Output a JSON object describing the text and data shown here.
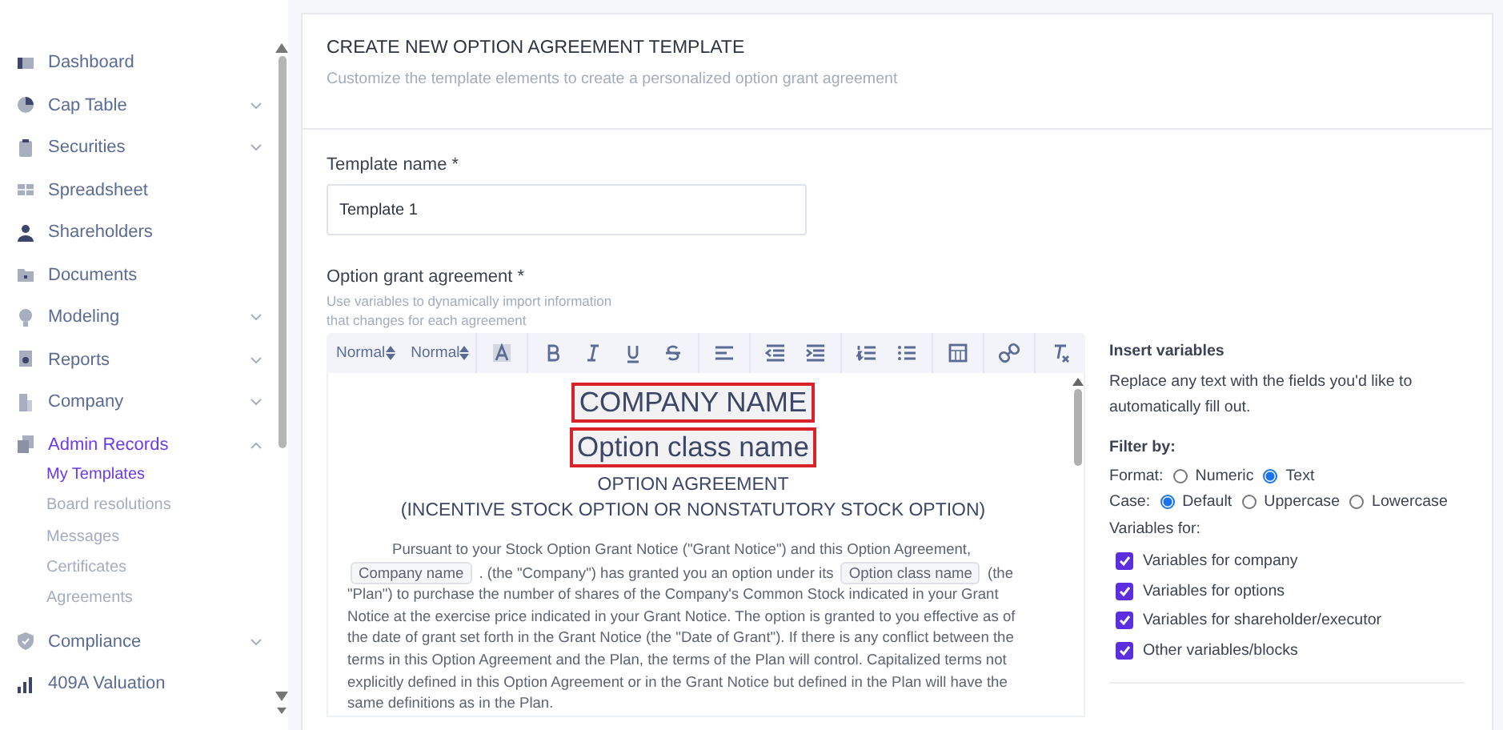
{
  "sidebar": {
    "items": [
      {
        "label": "Dashboard",
        "expandable": false,
        "expanded": false,
        "selected": false
      },
      {
        "label": "Cap Table",
        "expandable": true,
        "expanded": false,
        "selected": false
      },
      {
        "label": "Securities",
        "expandable": true,
        "expanded": false,
        "selected": false
      },
      {
        "label": "Spreadsheet",
        "expandable": false,
        "expanded": false,
        "selected": false
      },
      {
        "label": "Shareholders",
        "expandable": false,
        "expanded": false,
        "selected": false
      },
      {
        "label": "Documents",
        "expandable": false,
        "expanded": false,
        "selected": false
      },
      {
        "label": "Modeling",
        "expandable": true,
        "expanded": false,
        "selected": false
      },
      {
        "label": "Reports",
        "expandable": true,
        "expanded": false,
        "selected": false
      },
      {
        "label": "Company",
        "expandable": true,
        "expanded": false,
        "selected": false
      },
      {
        "label": "Admin Records",
        "expandable": true,
        "expanded": true,
        "selected": true,
        "children": [
          {
            "label": "My Templates",
            "selected": true
          },
          {
            "label": "Board resolutions",
            "selected": false
          },
          {
            "label": "Messages",
            "selected": false
          },
          {
            "label": "Certificates",
            "selected": false
          },
          {
            "label": "Agreements",
            "selected": false
          }
        ]
      },
      {
        "label": "Compliance",
        "expandable": true,
        "expanded": false,
        "selected": false
      },
      {
        "label": "409A Valuation",
        "expandable": false,
        "expanded": false,
        "selected": false
      }
    ]
  },
  "header": {
    "title": "CREATE NEW OPTION AGREEMENT TEMPLATE",
    "subtitle": "Customize the template elements to create a personalized option grant agreement"
  },
  "template_name": {
    "label": "Template name *",
    "value": "Template 1"
  },
  "agreement": {
    "label": "Option grant agreement *",
    "hint": "Use variables to dynamically import information that changes for each agreement",
    "toolbar": {
      "font": "Normal",
      "size": "Normal"
    },
    "document": {
      "headings": [
        {
          "text": "COMPANY NAME",
          "kind": "variable"
        },
        {
          "text": "Option class name",
          "kind": "variable"
        },
        {
          "text": "OPTION AGREEMENT",
          "kind": "plain"
        },
        {
          "text": "(INCENTIVE STOCK OPTION OR NONSTATUTORY STOCK OPTION)",
          "kind": "plain"
        }
      ],
      "paragraph": [
        {
          "kind": "text",
          "text": "Pursuant to your Stock Option Grant Notice (\"Grant Notice\") and this Option Agreement,"
        },
        {
          "kind": "chip",
          "text": "Company name"
        },
        {
          "kind": "text",
          "text": ". (the \"Company\") has granted you an option under its"
        },
        {
          "kind": "chip",
          "text": "Option class name"
        },
        {
          "kind": "text",
          "text": "(the \"Plan\") to purchase the number of shares of the Company's Common Stock indicated in your Grant Notice at the exercise price indicated in your Grant Notice. The option is granted to you effective as of the date of grant set forth in the Grant Notice (the \"Date of Grant\"). If there is any conflict between the terms in this Option Agreement and the Plan, the terms of the Plan will control. Capitalized terms not explicitly defined in this Option Agreement or in the Grant Notice but defined in the Plan will have the same definitions as in the Plan."
        }
      ]
    }
  },
  "variables_panel": {
    "title": "Insert variables",
    "description": "Replace any text with the fields you'd like to automatically fill out.",
    "filter_title": "Filter by:",
    "format": {
      "label": "Format:",
      "options": [
        {
          "label": "Numeric",
          "selected": false
        },
        {
          "label": "Text",
          "selected": true
        }
      ]
    },
    "case": {
      "label": "Case:",
      "options": [
        {
          "label": "Default",
          "selected": true
        },
        {
          "label": "Uppercase",
          "selected": false
        },
        {
          "label": "Lowercase",
          "selected": false
        }
      ]
    },
    "variables_for": {
      "label": "Variables for:",
      "options": [
        {
          "label": "Variables for company",
          "checked": true
        },
        {
          "label": "Variables for options",
          "checked": true
        },
        {
          "label": "Variables for shareholder/executor",
          "checked": true
        },
        {
          "label": "Other variables/blocks",
          "checked": true
        }
      ]
    }
  }
}
